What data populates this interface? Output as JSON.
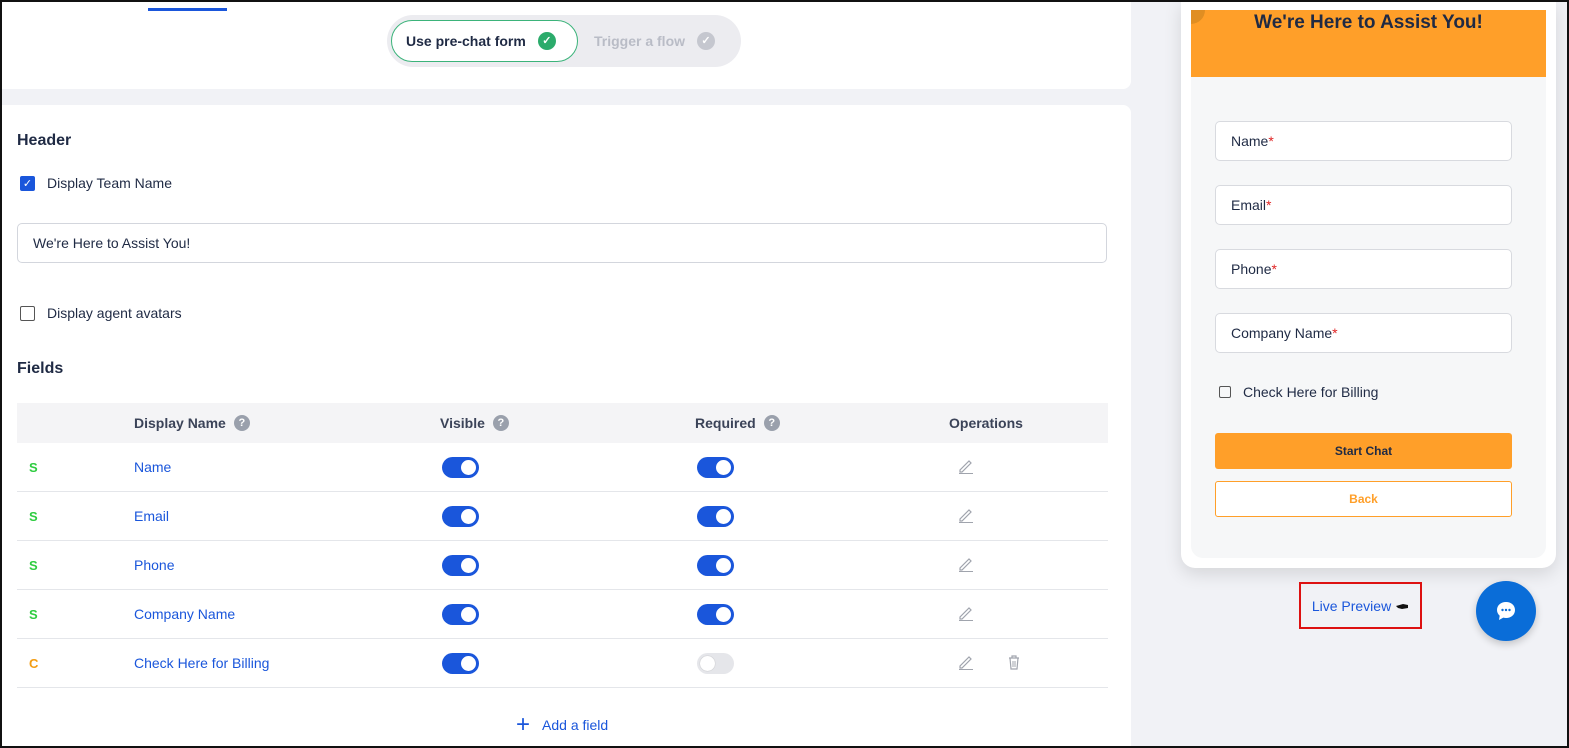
{
  "mode_toggle": {
    "prechat_label": "Use pre-chat form",
    "flow_label": "Trigger a flow"
  },
  "header_section": {
    "title": "Header",
    "display_team_name_label": "Display Team Name",
    "display_team_name_checked": true,
    "team_name_value": "We're Here to Assist You!",
    "display_avatars_label": "Display agent avatars",
    "display_avatars_checked": false
  },
  "fields_section": {
    "title": "Fields",
    "columns": {
      "display_name": "Display Name",
      "visible": "Visible",
      "required": "Required",
      "operations": "Operations"
    },
    "rows": [
      {
        "type": "S",
        "name": "Name",
        "visible": true,
        "required": true,
        "deletable": false
      },
      {
        "type": "S",
        "name": "Email",
        "visible": true,
        "required": true,
        "deletable": false
      },
      {
        "type": "S",
        "name": "Phone",
        "visible": true,
        "required": true,
        "deletable": false
      },
      {
        "type": "S",
        "name": "Company Name",
        "visible": true,
        "required": true,
        "deletable": false
      },
      {
        "type": "C",
        "name": "Check Here for Billing",
        "visible": true,
        "required": false,
        "deletable": true
      }
    ],
    "add_field_label": "Add a field"
  },
  "preview": {
    "title": "We're Here to Assist You!",
    "fields": [
      {
        "label": "Name",
        "marker": "*"
      },
      {
        "label": "Email",
        "marker": "*"
      },
      {
        "label": "Phone",
        "marker": "*"
      },
      {
        "label": "Company Name",
        "marker": "*"
      }
    ],
    "billing_label": "Check Here for Billing",
    "start_button": "Start Chat",
    "back_button": "Back"
  },
  "live_preview_label": "Live Preview",
  "colors": {
    "accent": "#1a56db",
    "brand_orange": "#ff9f29",
    "system_type": "#2ecc40",
    "custom_type": "#f39c12",
    "chat_bubble": "#0a6dd8"
  }
}
